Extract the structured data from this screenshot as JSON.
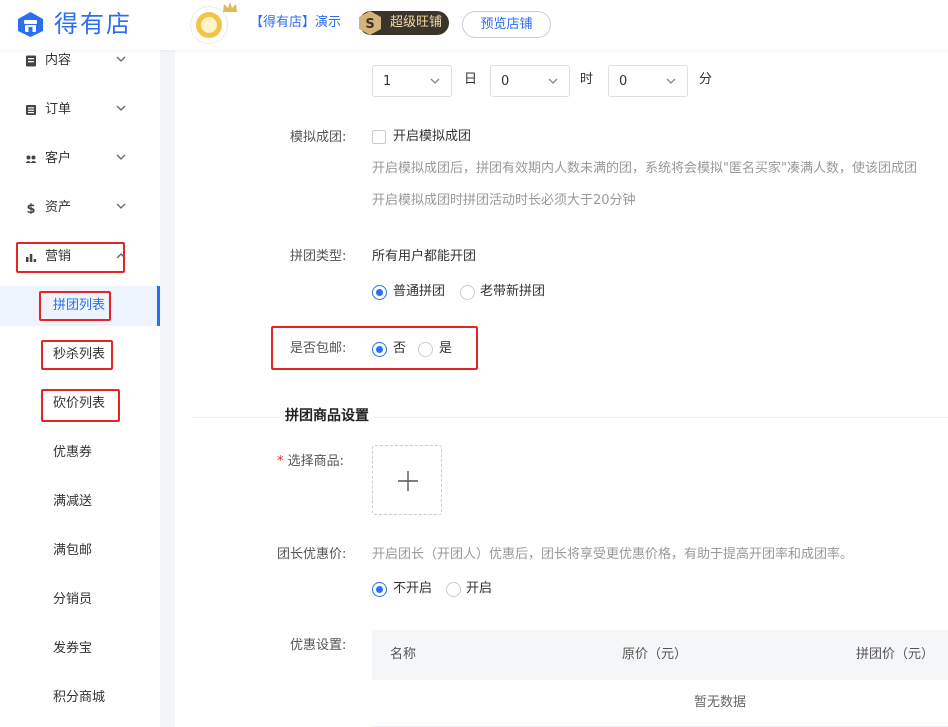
{
  "header": {
    "logo_text": "得有店",
    "shop_name": "【得有店】演示",
    "badge_letter": "S",
    "badge_label": "超级旺铺",
    "preview_label": "预览店铺"
  },
  "sidebar": {
    "items": [
      {
        "label": "内容",
        "icon": "document-icon"
      },
      {
        "label": "订单",
        "icon": "list-icon"
      },
      {
        "label": "客户",
        "icon": "users-icon"
      },
      {
        "label": "资产",
        "icon": "dollar-icon"
      },
      {
        "label": "营销",
        "icon": "bar-chart-icon"
      }
    ],
    "sub_items": [
      "拼团列表",
      "秒杀列表",
      "砍价列表",
      "优惠券",
      "满减送",
      "满包邮",
      "分销员",
      "发券宝",
      "积分商城"
    ]
  },
  "form": {
    "duration": {
      "day_value": "1",
      "day_unit": "日",
      "hour_value": "0",
      "hour_unit": "时",
      "minute_value": "0",
      "minute_unit": "分"
    },
    "simulate": {
      "label": "模拟成团:",
      "checkbox_label": "开启模拟成团",
      "hint1": "开启模拟成团后，拼团有效期内人数未满的团，系统将会模拟\"匿名买家\"凑满人数，使该团成团",
      "hint2": "开启模拟成团时拼团活动时长必须大于20分钟"
    },
    "group_type": {
      "label": "拼团类型:",
      "value": "所有用户都能开团",
      "option_normal": "普通拼团",
      "option_old_new": "老带新拼团"
    },
    "free_shipping": {
      "label": "是否包邮:",
      "option_no": "否",
      "option_yes": "是"
    },
    "section_title": "拼团商品设置",
    "select_goods": {
      "required_mark": "*",
      "label": "选择商品:"
    },
    "leader_discount": {
      "label": "团长优惠价:",
      "hint": "开启团长（开团人）优惠后，团长将享受更优惠价格，有助于提高开团率和成团率。",
      "option_off": "不开启",
      "option_on": "开启"
    },
    "discount_setting": {
      "label": "优惠设置:",
      "columns": [
        "名称",
        "原价（元）",
        "拼团价（元）"
      ],
      "empty_text": "暂无数据"
    }
  },
  "colors": {
    "accent": "#2b6ef0",
    "highlight": "#e52525"
  }
}
